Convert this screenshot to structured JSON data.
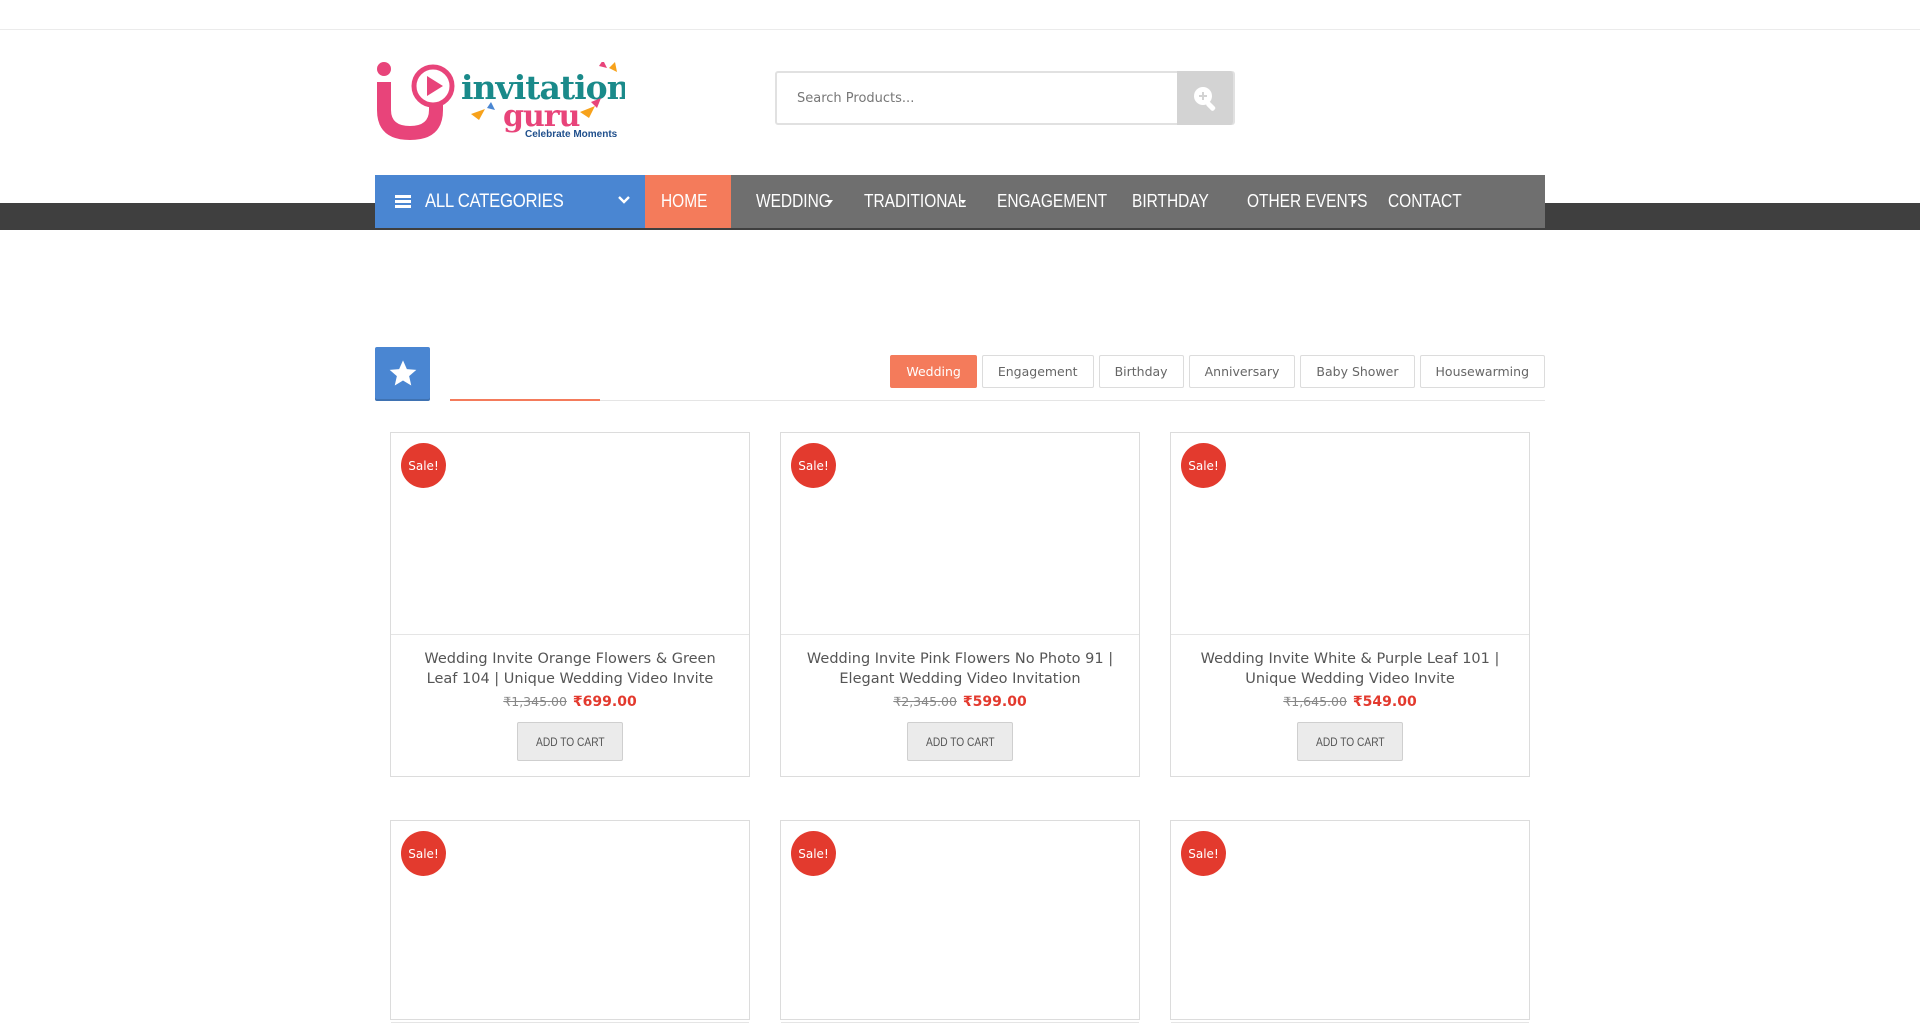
{
  "brand": {
    "logo_text_top": "invitation",
    "logo_text_bottom": "guru",
    "tagline": "Celebrate Moments",
    "colors": {
      "pink": "#e8447a",
      "teal": "#1a8a8a",
      "navy": "#1f4f8c"
    }
  },
  "search": {
    "placeholder": "Search Products...",
    "button_icon": "search-icon"
  },
  "nav": {
    "all_categories": "ALL CATEGORIES",
    "items": [
      {
        "label": "HOME",
        "active": true,
        "has_submenu": false
      },
      {
        "label": "WEDDING",
        "active": false,
        "has_submenu": true
      },
      {
        "label": "TRADITIONAL",
        "active": false,
        "has_submenu": true
      },
      {
        "label": "ENGAGEMENT",
        "active": false,
        "has_submenu": false
      },
      {
        "label": "BIRTHDAY",
        "active": false,
        "has_submenu": false
      },
      {
        "label": "OTHER EVENTS",
        "active": false,
        "has_submenu": true
      },
      {
        "label": "CONTACT",
        "active": false,
        "has_submenu": false
      }
    ],
    "colors": {
      "bar": "#6f6f6f",
      "categories": "#4a86d2",
      "active": "#f47b5b"
    }
  },
  "section": {
    "icon": "star-icon",
    "filters": [
      {
        "label": "Wedding",
        "active": true
      },
      {
        "label": "Engagement",
        "active": false
      },
      {
        "label": "Birthday",
        "active": false
      },
      {
        "label": "Anniversary",
        "active": false
      },
      {
        "label": "Baby Shower",
        "active": false
      },
      {
        "label": "Housewarming",
        "active": false
      }
    ]
  },
  "products": [
    {
      "badge": "Sale!",
      "name": "Wedding Invite Orange Flowers & Green Leaf 104 | Unique Wedding Video Invite",
      "old_price": "₹1,345.00",
      "price": "₹699.00",
      "cta": "ADD TO CART"
    },
    {
      "badge": "Sale!",
      "name": "Wedding Invite Pink Flowers No Photo 91 | Elegant Wedding Video Invitation",
      "old_price": "₹2,345.00",
      "price": "₹599.00",
      "cta": "ADD TO CART"
    },
    {
      "badge": "Sale!",
      "name": "Wedding Invite White & Purple Leaf 101 | Unique Wedding Video Invite",
      "old_price": "₹1,645.00",
      "price": "₹549.00",
      "cta": "ADD TO CART"
    },
    {
      "badge": "Sale!"
    },
    {
      "badge": "Sale!"
    },
    {
      "badge": "Sale!"
    }
  ]
}
